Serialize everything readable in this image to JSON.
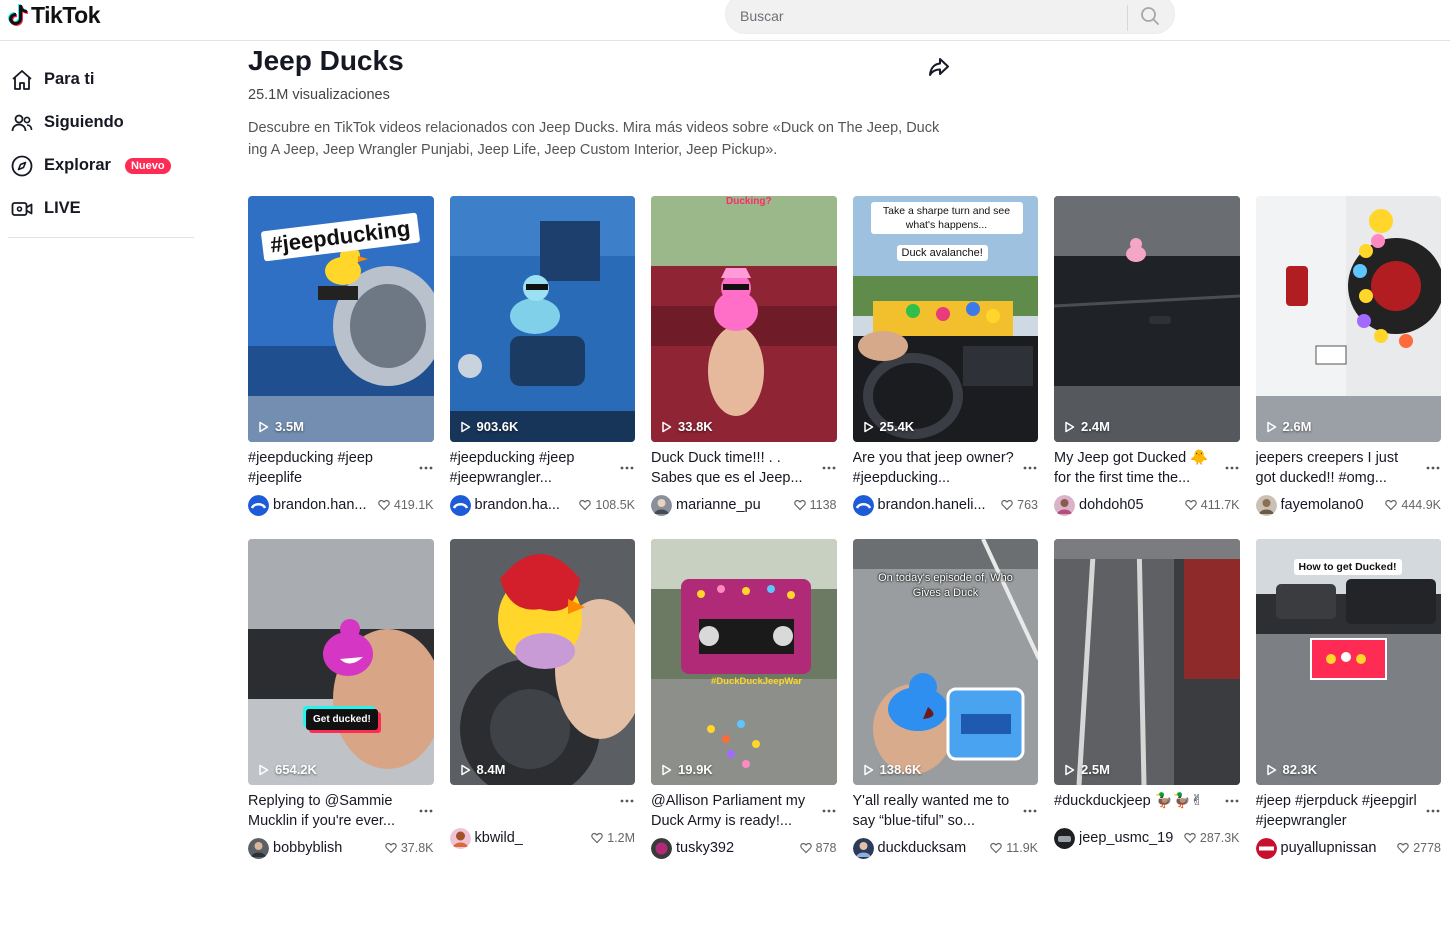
{
  "header": {
    "logo_text": "TikTok",
    "search_placeholder": "Buscar"
  },
  "sidebar": {
    "items": [
      {
        "label": "Para ti",
        "icon": "home-icon"
      },
      {
        "label": "Siguiendo",
        "icon": "following-icon"
      },
      {
        "label": "Explorar",
        "icon": "compass-icon",
        "badge": "Nuevo"
      },
      {
        "label": "LIVE",
        "icon": "live-icon"
      }
    ]
  },
  "topic": {
    "title": "Jeep Ducks",
    "views": "25.1M visualizaciones",
    "description": "Descubre en TikTok videos relacionados con Jeep Ducks. Mira más videos sobre «Duck on The Jeep, Duck ing A Jeep, Jeep Wrangler Punjabi, Jeep Life, Jeep Custom Interior, Jeep Pickup»."
  },
  "videos": [
    {
      "views": "3.5M",
      "caption": "#jeepducking #jeep #jeeplife",
      "user": "brandon.han...",
      "likes": "419.1K",
      "overlay": "#jeepducking"
    },
    {
      "views": "903.6K",
      "caption": "#jeepducking #jeep #jeepwrangler...",
      "user": "brandon.ha...",
      "likes": "108.5K"
    },
    {
      "views": "33.8K",
      "caption": "Duck Duck time!!! . . Sabes que es el Jeep...",
      "user": "marianne_pu",
      "likes": "1138",
      "overlay": "Ducking?"
    },
    {
      "views": "25.4K",
      "caption": "Are you that jeep owner? #jeepducking...",
      "user": "brandon.haneli...",
      "likes": "763",
      "overlay": "Take a sharpe turn and see what's happens...",
      "overlay2": "Duck avalanche!"
    },
    {
      "views": "2.4M",
      "caption": "My Jeep got Ducked 🐥 for the first time the...",
      "user": "dohdoh05",
      "likes": "411.7K"
    },
    {
      "views": "2.6M",
      "caption": "jeepers creepers I just got ducked!! #omg...",
      "user": "fayemolano0",
      "likes": "444.9K"
    },
    {
      "views": "654.2K",
      "caption": "Replying to @Sammie Mucklin if you're ever...",
      "user": "bobbyblish",
      "likes": "37.8K",
      "overlay": "Get ducked!"
    },
    {
      "views": "8.4M",
      "caption": "",
      "user": "kbwild_",
      "likes": "1.2M"
    },
    {
      "views": "19.9K",
      "caption": "@Allison Parliament my Duck Army is ready!...",
      "user": "tusky392",
      "likes": "878",
      "overlay": "#DuckDuckJeepWar"
    },
    {
      "views": "138.6K",
      "caption": "Y'all really wanted me to say “blue-tiful” so...",
      "user": "duckducksam",
      "likes": "11.9K",
      "overlay": "On today's episode of, Who Gives a Duck"
    },
    {
      "views": "2.5M",
      "caption": "#duckduckjeep 🦆🦆✌",
      "user": "jeep_usmc_19",
      "likes": "287.3K"
    },
    {
      "views": "82.3K",
      "caption": "#jeep #jerpduck #jeepgirl #jeepwrangler",
      "user": "puyallupnissan",
      "likes": "2778",
      "overlay": "How to get Ducked!"
    }
  ],
  "colors": {
    "accent": "#fe2c55",
    "text": "#161823"
  }
}
